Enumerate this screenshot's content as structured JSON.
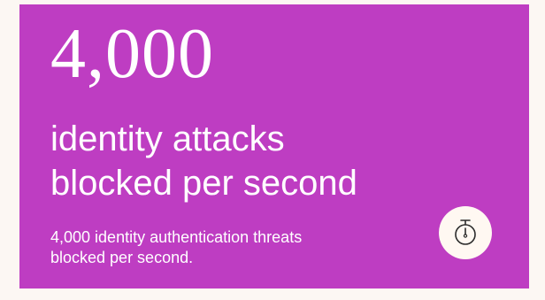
{
  "stat": {
    "number": "4,000",
    "headline_line1": "identity attacks",
    "headline_line2": "blocked per second",
    "description_line1": "4,000 identity authentication threats",
    "description_line2": "blocked per second."
  },
  "icon": {
    "name": "stopwatch-icon"
  },
  "colors": {
    "page_background": "#fcf7f3",
    "card_background": "#be3dc2",
    "text": "#ffffff",
    "icon_badge": "#fff8f2",
    "icon_stroke": "#2b2b2b"
  }
}
